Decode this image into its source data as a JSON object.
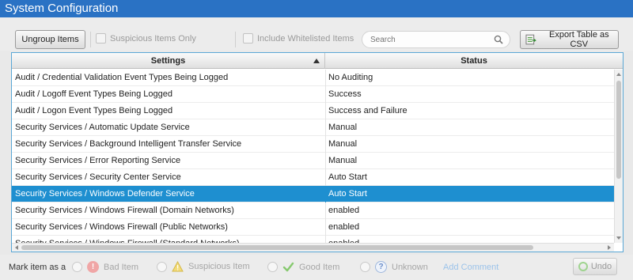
{
  "window": {
    "title": "System Configuration"
  },
  "toolbar": {
    "ungroup_label": "Ungroup Items",
    "suspicious_only_label": "Suspicious Items Only",
    "include_whitelisted_label": "Include Whitelisted Items",
    "search_placeholder": "Search",
    "export_label": "Export Table as CSV"
  },
  "table": {
    "columns": [
      "Settings",
      "Status"
    ],
    "sort_column": "Settings",
    "sort_direction": "ascending",
    "selected_row_index": 7,
    "rows": [
      {
        "setting": "Audit / Credential Validation Event Types Being Logged",
        "status": "No Auditing"
      },
      {
        "setting": "Audit / Logoff Event Types Being Logged",
        "status": "Success"
      },
      {
        "setting": "Audit / Logon Event Types Being Logged",
        "status": "Success and Failure"
      },
      {
        "setting": "Security Services / Automatic Update Service",
        "status": "Manual"
      },
      {
        "setting": "Security Services / Background Intelligent Transfer Service",
        "status": "Manual"
      },
      {
        "setting": "Security Services / Error Reporting Service",
        "status": "Manual"
      },
      {
        "setting": "Security Services / Security Center Service",
        "status": "Auto Start"
      },
      {
        "setting": "Security Services / Windows Defender Service",
        "status": "Auto Start"
      },
      {
        "setting": "Security Services / Windows Firewall (Domain Networks)",
        "status": "enabled"
      },
      {
        "setting": "Security Services / Windows Firewall (Public Networks)",
        "status": "enabled"
      },
      {
        "setting": "Security Services / Windows Firewall (Standard Networks)",
        "status": "enabled"
      }
    ]
  },
  "bottombar": {
    "mark_label": "Mark item as a",
    "bad_label": "Bad Item",
    "suspicious_label": "Suspicious Item",
    "good_label": "Good Item",
    "unknown_label": "Unknown",
    "add_comment_label": "Add Comment",
    "undo_label": "Undo"
  },
  "colors": {
    "titlebar": "#2a72c4",
    "selection": "#1e8fd0",
    "table_border": "#5aa7d6"
  },
  "icons": [
    "search-icon",
    "csv-export-icon",
    "sort-ascending-icon",
    "bad-item-icon",
    "warning-icon",
    "checkmark-icon",
    "question-icon",
    "undo-icon"
  ]
}
